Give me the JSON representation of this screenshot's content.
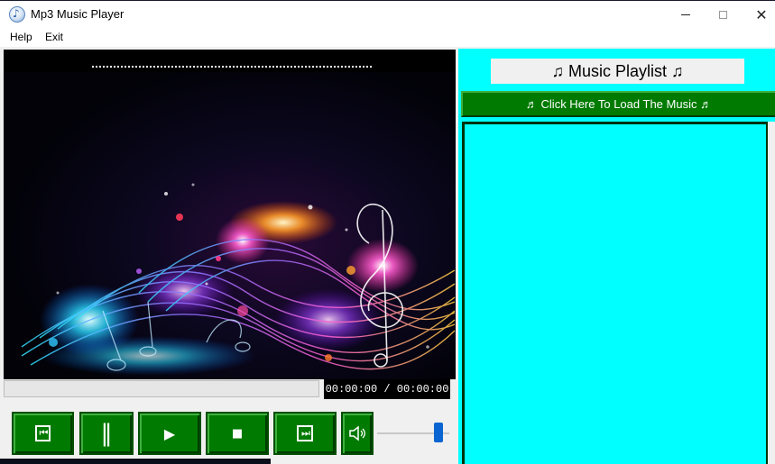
{
  "window": {
    "title": "Mp3 Music Player",
    "controls": {
      "minimize": "—",
      "maximize": "□",
      "close": "✕"
    }
  },
  "menu": {
    "items": [
      "Help",
      "Exit"
    ]
  },
  "player": {
    "time_display": "00:00:00 / 00:00:00",
    "progress": 0,
    "volume": 0.9,
    "buttons": {
      "previous": "⏮",
      "pause": "‖",
      "play": "▶",
      "stop": "■",
      "next": "⏭",
      "volume": "🔈"
    }
  },
  "playlist": {
    "title": "♫ Music Playlist ♫",
    "load_button": "♬ Click Here To Load The Music ♬",
    "items": []
  },
  "colors": {
    "accent_green": "#007a00",
    "playlist_bg": "#00ffff",
    "slider_blue": "#0a64d2"
  }
}
